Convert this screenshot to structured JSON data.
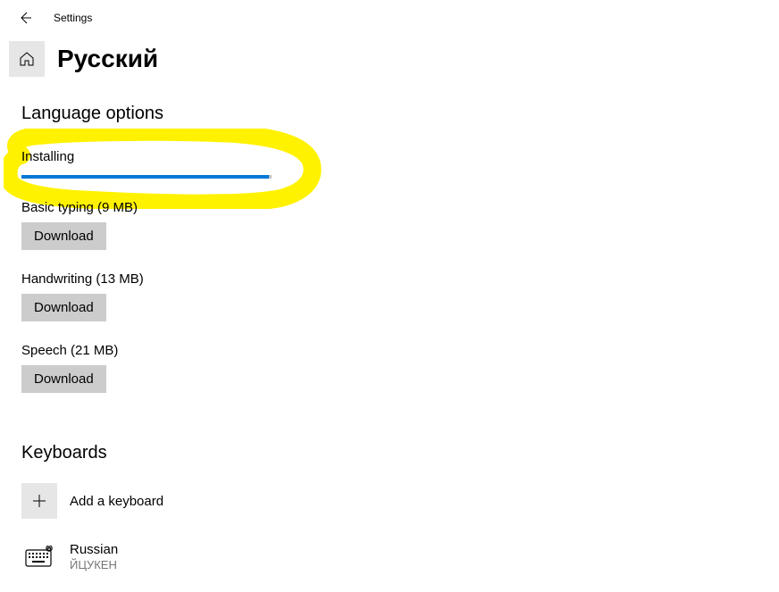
{
  "header": {
    "title": "Settings"
  },
  "page": {
    "title": "Русский"
  },
  "sections": {
    "language_options": "Language options",
    "keyboards": "Keyboards"
  },
  "installing": {
    "label": "Installing",
    "progress_percent": 99
  },
  "options": {
    "basic_typing": {
      "label": "Basic typing (9 MB)",
      "button": "Download"
    },
    "handwriting": {
      "label": "Handwriting (13 MB)",
      "button": "Download"
    },
    "speech": {
      "label": "Speech (21 MB)",
      "button": "Download"
    }
  },
  "keyboards": {
    "add_label": "Add a keyboard",
    "items": [
      {
        "name": "Russian",
        "subtitle": "ЙЦУКЕН"
      }
    ]
  },
  "colors": {
    "accent": "#0078d7",
    "button_bg": "#cccccc",
    "box_bg": "#e6e6e6",
    "highlight": "#fff200"
  }
}
